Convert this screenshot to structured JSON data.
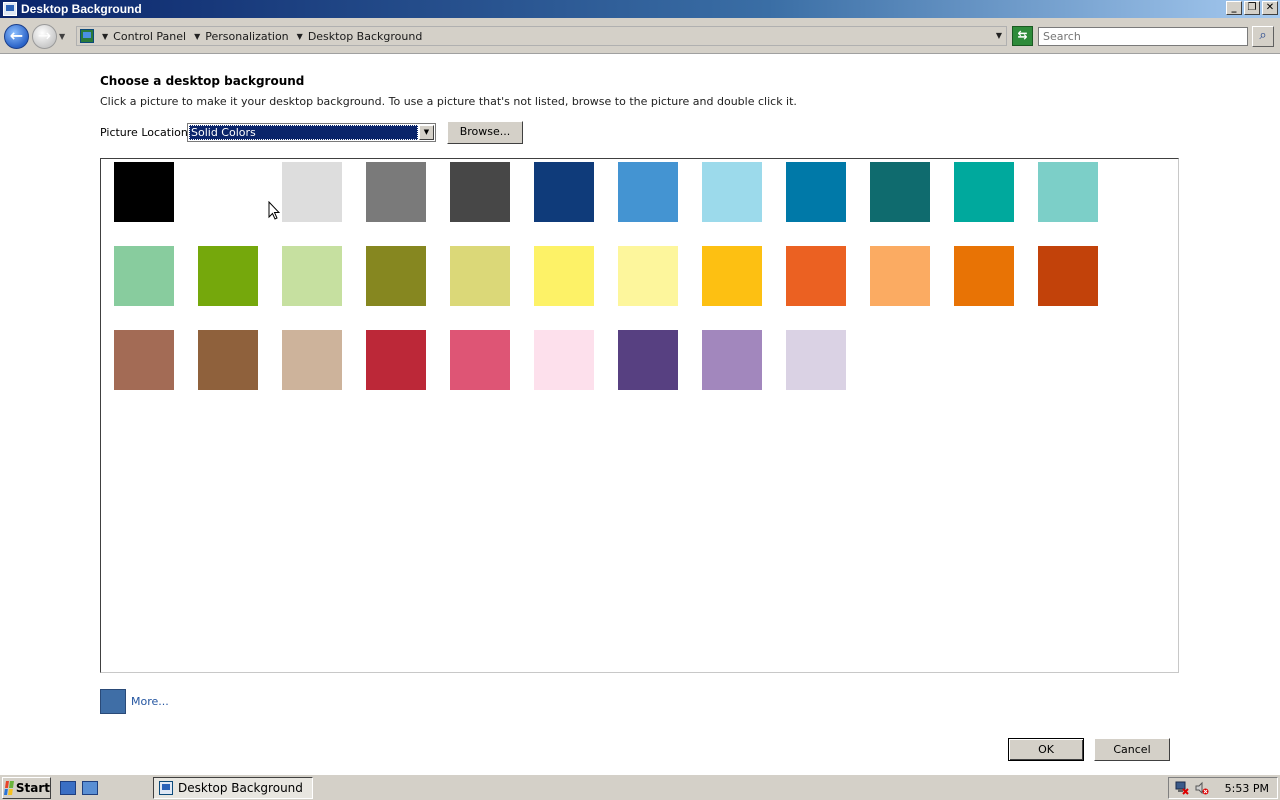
{
  "window": {
    "title": "Desktop Background"
  },
  "address": {
    "breadcrumbs": [
      "Control Panel",
      "Personalization",
      "Desktop Background"
    ],
    "search_placeholder": "Search"
  },
  "content": {
    "heading": "Choose a desktop background",
    "instruction": "Click a picture to make it your desktop background. To use a picture that's not listed, browse to the picture and double click it.",
    "location_label": "Picture Location",
    "location_value": "Solid Colors",
    "browse_label": "Browse...",
    "more_label": "More...",
    "more_color": "#3f6ea6",
    "ok_label": "OK",
    "cancel_label": "Cancel"
  },
  "swatches": [
    [
      "#000000",
      "#ffffff",
      "#dddddd",
      "#7a7a7a",
      "#474747",
      "#0f3b7a",
      "#4494d2",
      "#9cdaeb",
      "#0079a8",
      "#0f6b6e",
      "#00a99d",
      "#7ccfc8"
    ],
    [
      "#88cc9e",
      "#75a80c",
      "#c6e0a0",
      "#868720",
      "#dbd878",
      "#fdf267",
      "#fdf69c",
      "#fdc012",
      "#eb6122",
      "#fbab62",
      "#e87305",
      "#c2420a"
    ],
    [
      "#a36b55",
      "#8f613c",
      "#cdb39b",
      "#bc2838",
      "#de5575",
      "#fde0ec",
      "#574081",
      "#a287bd",
      "#dad2e4"
    ]
  ],
  "taskbar": {
    "start_label": "Start",
    "task_label": "Desktop Background",
    "clock": "5:53 PM"
  }
}
